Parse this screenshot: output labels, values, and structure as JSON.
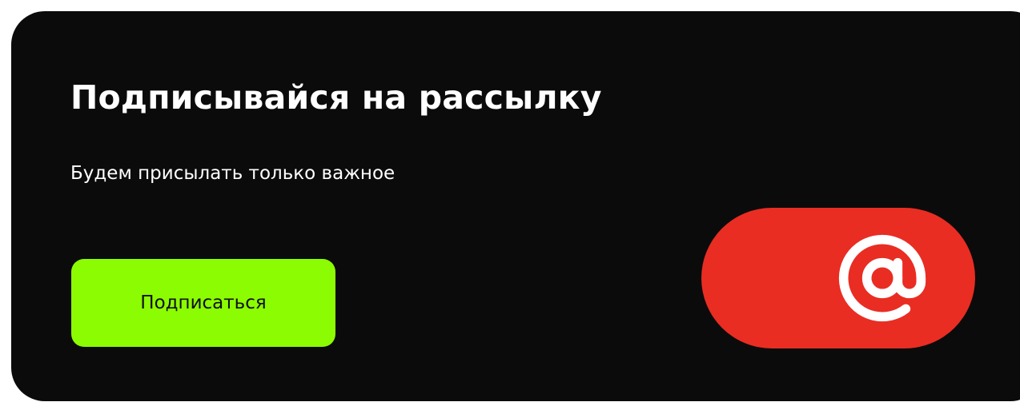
{
  "newsletter": {
    "title": "Подписывайся на рассылку",
    "subtitle": "Будем присылать только важное",
    "subscribe_label": "Подписаться",
    "icon": "at-sign-icon"
  },
  "colors": {
    "card_background": "#0b0b0b",
    "text": "#ffffff",
    "button_background": "#8cfc03",
    "button_text": "#111111",
    "pill_background": "#e92d23",
    "icon_color": "#ffffff"
  }
}
